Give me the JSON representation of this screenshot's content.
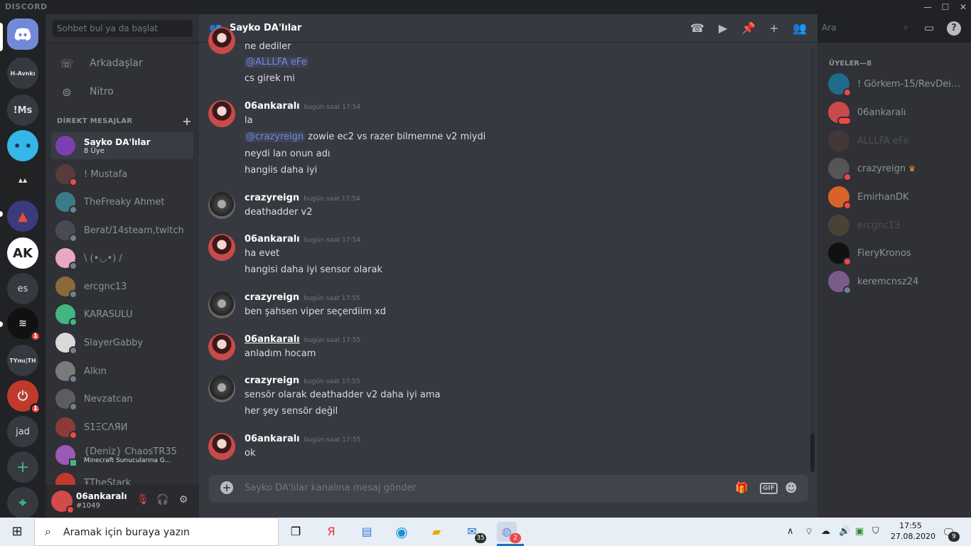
{
  "app": {
    "brand": "DISCORD"
  },
  "window_controls": {
    "minimize": "—",
    "maximize": "☐",
    "close": "✕"
  },
  "guilds": [
    {
      "label": "",
      "icon": "discord-home-icon"
    },
    {
      "label": "H-Avnkı"
    },
    {
      "label": "!Ms"
    },
    {
      "label": ""
    },
    {
      "label": ""
    },
    {
      "label": ""
    },
    {
      "label": "AK"
    },
    {
      "label": "es"
    },
    {
      "label": "",
      "badge": "1"
    },
    {
      "label": "TYmı|TH"
    },
    {
      "label": "",
      "badge": "1"
    },
    {
      "label": "jad"
    },
    {
      "label": "+"
    },
    {
      "label": "⌖"
    }
  ],
  "sidebar": {
    "search_placeholder": "Sohbet bul ya da başlat",
    "nav": [
      {
        "label": "Arkadaşlar",
        "icon": "friends-icon"
      },
      {
        "label": "Nitro",
        "icon": "nitro-icon"
      }
    ],
    "dm_header": "DİREKT MESAJLAR",
    "dm_add": "+",
    "dms": [
      {
        "name": "Sayko DA'lılar",
        "sub": "8 Üye",
        "color": "#7a3fb0"
      },
      {
        "name": "! Mustafa",
        "sub": "",
        "color": "#5a3b3b",
        "status": "dnd"
      },
      {
        "name": "TheFreaky Ahmet",
        "sub": "",
        "color": "#3a7b89",
        "status": "off"
      },
      {
        "name": "Berat/14steam,twitch",
        "sub": "",
        "color": "#4a4a55",
        "status": "off"
      },
      {
        "name": "\\ (•◡•) /",
        "sub": "",
        "color": "#e7a9c2",
        "status": "off"
      },
      {
        "name": "ercgnc13",
        "sub": "",
        "color": "#8a6a3a",
        "status": "off"
      },
      {
        "name": "KARASULU",
        "sub": "",
        "color": "#43b581",
        "status": "on"
      },
      {
        "name": "SlayerGabby",
        "sub": "",
        "color": "#d9d9d9",
        "status": "off"
      },
      {
        "name": "Alkın",
        "sub": "",
        "color": "#7a7a7a",
        "status": "off"
      },
      {
        "name": "Nevzatcan",
        "sub": "",
        "color": "#5d5d5d",
        "status": "off"
      },
      {
        "name": "S1ΞCΛЯИ",
        "sub": "",
        "color": "#8b3a3a",
        "status": "dnd"
      },
      {
        "name": "{Deniz} ChaosTR35",
        "sub": "Minecraft Sunucularına G...",
        "color": "#9b59b6",
        "status": "on"
      },
      {
        "name": "ŦTheStark",
        "sub": "",
        "color": "#c0392b",
        "status": "off"
      }
    ]
  },
  "user_panel": {
    "name": "06ankaralı",
    "tag": "#1049"
  },
  "channel": {
    "title": "Sayko DA'lılar",
    "composer_placeholder": "Sayko DA'lılar kanalına mesaj gönder",
    "gif_label": "GIF"
  },
  "messages": {
    "partial": [
      {
        "text": "ne dediler"
      },
      {
        "mention": "@ALLLFA eFe"
      },
      {
        "text": "cs girek mi"
      }
    ],
    "groups": [
      {
        "author": "06ankaralı",
        "time": "bugün saat 17:54",
        "lines": [
          "la",
          "@crazyreign| zowie ec2 vs razer bilmemne v2 miydi",
          "neydi lan onun adı",
          "hangiis daha iyi"
        ]
      },
      {
        "author": "crazyreign",
        "time": "bugün saat 17:54",
        "lines": [
          "deathadder v2"
        ]
      },
      {
        "author": "06ankaralı",
        "time": "bugün saat 17:54",
        "lines": [
          "ha evet",
          "hangisi daha iyi sensor olarak"
        ]
      },
      {
        "author": "crazyreign",
        "time": "bugün saat 17:55",
        "lines": [
          "ben şahsen viper seçerdiim xd"
        ]
      },
      {
        "author": "06ankaralı",
        "time": "bugün saat 17:55",
        "lines": [
          "anladım hocam"
        ]
      },
      {
        "author": "crazyreign",
        "time": "bugün saat 17:55",
        "lines": [
          "sensör olarak deathadder v2 daha iyi ama",
          "her şey sensör değil"
        ]
      },
      {
        "author": "06ankaralı",
        "time": "bugün saat 17:55",
        "lines": [
          "ok"
        ]
      }
    ],
    "mention_crazyreign": "@crazyreign",
    "line_zowie": "zowie ec2 vs razer bilmemne v2 miydi"
  },
  "members": {
    "search_placeholder": "Ara",
    "header": "ÜYELER—8",
    "list": [
      {
        "name": "! Görkem-15/RevDeis...",
        "color": "#1f6b8a"
      },
      {
        "name": "06ankaralı",
        "color": "#c94a4a"
      },
      {
        "name": "ALLLFA eFe",
        "color": "#6b4a3a"
      },
      {
        "name": "crazyreign",
        "color": "#555",
        "crown": "♛"
      },
      {
        "name": "EmirhanDK",
        "color": "#d9622b"
      },
      {
        "name": "ercgnc13",
        "color": "#8a6a3a"
      },
      {
        "name": "FieryKronos",
        "color": "#111"
      },
      {
        "name": "keremcnsz24",
        "color": "#7b5b8b"
      }
    ]
  },
  "taskbar": {
    "search_text": "Aramak için buraya yazın",
    "mail_badge": "35",
    "discord_badge": "2",
    "time": "17:55",
    "date": "27.08.2020",
    "notif_badge": "9"
  }
}
